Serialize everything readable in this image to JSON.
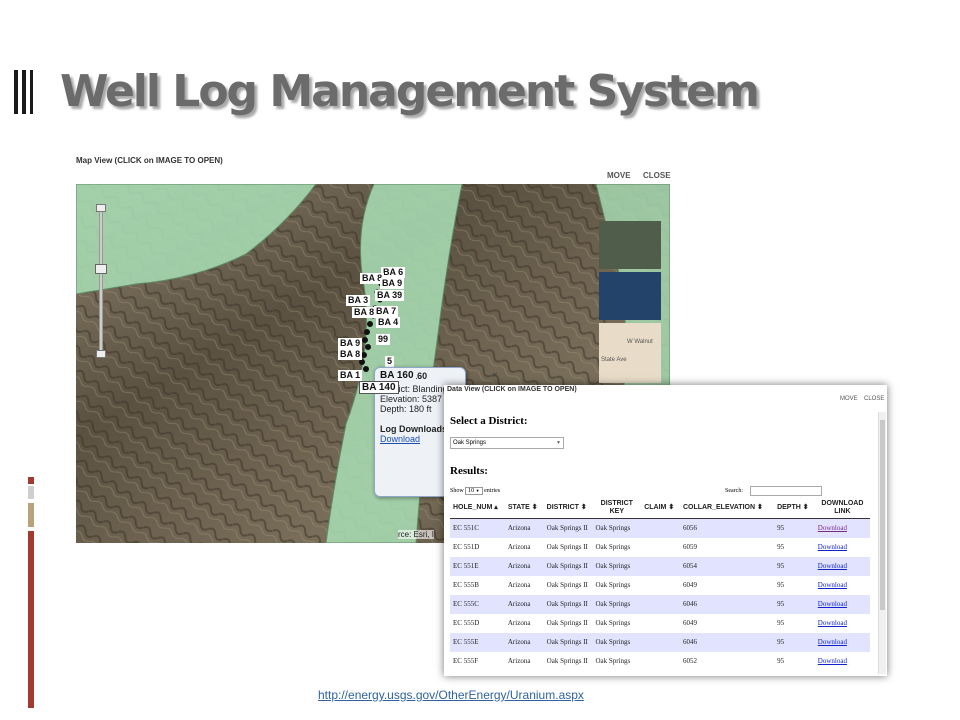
{
  "slide": {
    "title": "Well Log Management System",
    "link": "http://energy.usgs.gov/OtherEnergy/Uranium.aspx"
  },
  "map_view": {
    "caption": "Map View (CLICK on IMAGE TO OPEN)",
    "move_label": "MOVE",
    "close_label": "CLOSE",
    "attribution": "rce: Esri, I",
    "markers": [
      "BA 6",
      "BA 8",
      "BA 9",
      "BA 39",
      "BA 3",
      "BA 7",
      "BA 8",
      "BA 4",
      "BA 9",
      "99",
      "BA 8",
      "BA 1",
      "5",
      "BA 160",
      "BA 140"
    ],
    "popup": {
      "title": "No. BA 160",
      "close_glyph": "×",
      "lines": [
        "District: Blanding",
        "Elevation: 5387 ft",
        "Depth: 180 ft"
      ],
      "section": "Log Downloads",
      "download": "Download"
    },
    "basemap_labels": [
      "W Walnut",
      "State Ave"
    ]
  },
  "data_view": {
    "caption": "Data View (CLICK on IMAGE TO OPEN)",
    "move_label": "MOVE",
    "close_label": "CLOSE",
    "district_heading": "Select a District:",
    "district_selected": "Oak Springs",
    "results_heading": "Results:",
    "show_label": "Show",
    "show_value": "10",
    "entries_label": "entries",
    "search_label": "Search:",
    "columns": [
      "HOLE_NUM",
      "STATE",
      "DISTRICT",
      "DISTRICT KEY",
      "CLAIM",
      "COLLAR_ELEVATION",
      "DEPTH",
      "DOWNLOAD LINK"
    ],
    "rows": [
      {
        "hole": "EC 551C",
        "state": "Arizona",
        "district": "Oak Springs II",
        "key": "Oak Springs",
        "claim": "",
        "elev": "6056",
        "depth": "95",
        "link": "Download"
      },
      {
        "hole": "EC 551D",
        "state": "Arizona",
        "district": "Oak Springs II",
        "key": "Oak Springs",
        "claim": "",
        "elev": "6059",
        "depth": "95",
        "link": "Download"
      },
      {
        "hole": "EC 551E",
        "state": "Arizona",
        "district": "Oak Springs II",
        "key": "Oak Springs",
        "claim": "",
        "elev": "6054",
        "depth": "95",
        "link": "Download"
      },
      {
        "hole": "EC 555B",
        "state": "Arizona",
        "district": "Oak Springs II",
        "key": "Oak Springs",
        "claim": "",
        "elev": "6049",
        "depth": "95",
        "link": "Download"
      },
      {
        "hole": "EC 555C",
        "state": "Arizona",
        "district": "Oak Springs II",
        "key": "Oak Springs",
        "claim": "",
        "elev": "6046",
        "depth": "95",
        "link": "Download"
      },
      {
        "hole": "EC 555D",
        "state": "Arizona",
        "district": "Oak Springs II",
        "key": "Oak Springs",
        "claim": "",
        "elev": "6049",
        "depth": "95",
        "link": "Download"
      },
      {
        "hole": "EC 555E",
        "state": "Arizona",
        "district": "Oak Springs II",
        "key": "Oak Springs",
        "claim": "",
        "elev": "6046",
        "depth": "95",
        "link": "Download"
      },
      {
        "hole": "EC 555F",
        "state": "Arizona",
        "district": "Oak Springs II",
        "key": "Oak Springs",
        "claim": "",
        "elev": "6052",
        "depth": "95",
        "link": "Download"
      }
    ]
  },
  "colors": {
    "title": "#6b6b6b",
    "accent_bar": "#a33a2e",
    "odd_row": "#e2e4ff",
    "link": "#1122cc",
    "map_polygon": "#a6d9b0"
  }
}
